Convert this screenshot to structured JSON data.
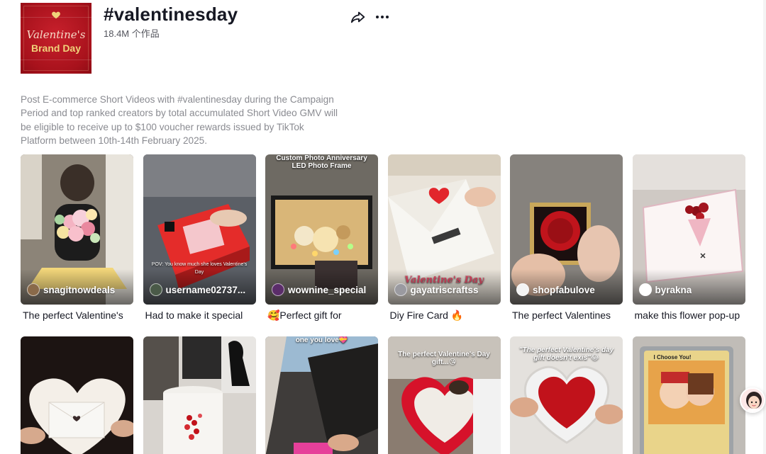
{
  "hashtag": {
    "title": "#valentinesday",
    "post_count": "18.4M 个作品",
    "cover": {
      "line1": "Valentine's",
      "line2": "Brand Day",
      "color": "#a8121c"
    },
    "share_icon": "share-arrow-icon",
    "more_icon": "more-horizontal-icon"
  },
  "description": "Post E-commerce Short Videos with #valentinesday during the Campaign Period and top ranked creators by total accumulated Short Video GMV will be eligible to receive up to $100 voucher rewards issued by TikTok Platform between 10th-14th February 2025.",
  "videos": [
    {
      "creator": "snagitnowdeals",
      "caption": "The perfect Valentine's",
      "overlay": ""
    },
    {
      "creator": "username02737...",
      "caption": "Had to make it special",
      "overlay": "POV: You know much she loves Valentine's Day"
    },
    {
      "creator": "wownine_special",
      "caption": "🥰Perfect gift for",
      "overlay": "Custom Photo Anniversary LED Photo Frame"
    },
    {
      "creator": "gayatriscraftss",
      "caption": "Diy Fire Card 🔥",
      "overlay": ""
    },
    {
      "creator": "shopfabulove",
      "caption": "The perfect Valentines",
      "overlay": ""
    },
    {
      "creator": "byrakna",
      "caption": "make this flower pop-up",
      "overlay": ""
    },
    {
      "creator": "",
      "caption": "",
      "overlay": ""
    },
    {
      "creator": "",
      "caption": "",
      "overlay": ""
    },
    {
      "creator": "",
      "caption": "",
      "overlay": ""
    },
    {
      "creator": "",
      "caption": "",
      "overlay": "The perfect Valentine's Day gift...😘"
    },
    {
      "creator": "",
      "caption": "",
      "overlay": "\"The perfect Valentine's day gift doesn't exis\"😂"
    },
    {
      "creator": "",
      "caption": "",
      "overlay": ""
    }
  ]
}
